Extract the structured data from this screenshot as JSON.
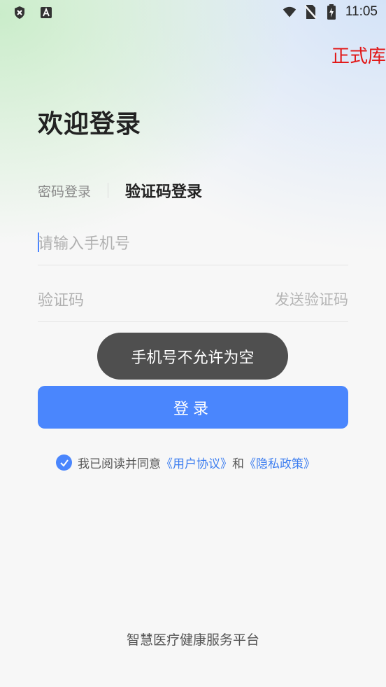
{
  "status_bar": {
    "time": "11:05"
  },
  "env_tag": "正式库",
  "page_title": "欢迎登录",
  "tabs": {
    "password_login": "密码登录",
    "code_login": "验证码登录"
  },
  "phone_field": {
    "placeholder": "请输入手机号"
  },
  "code_field": {
    "placeholder": "验证码",
    "send_code": "发送验证码"
  },
  "toast": "手机号不允许为空",
  "login_button": "登录",
  "agreement": {
    "prefix": "我已阅读并同意",
    "user_agreement": "《用户协议》",
    "and": "和",
    "privacy_policy": "《隐私政策》",
    "checked": true
  },
  "footer": "智慧医疗健康服务平台",
  "colors": {
    "primary": "#4a86fd",
    "env_tag": "#e21515",
    "toast_bg": "#4f4f4f",
    "link": "#3d7ef0"
  }
}
